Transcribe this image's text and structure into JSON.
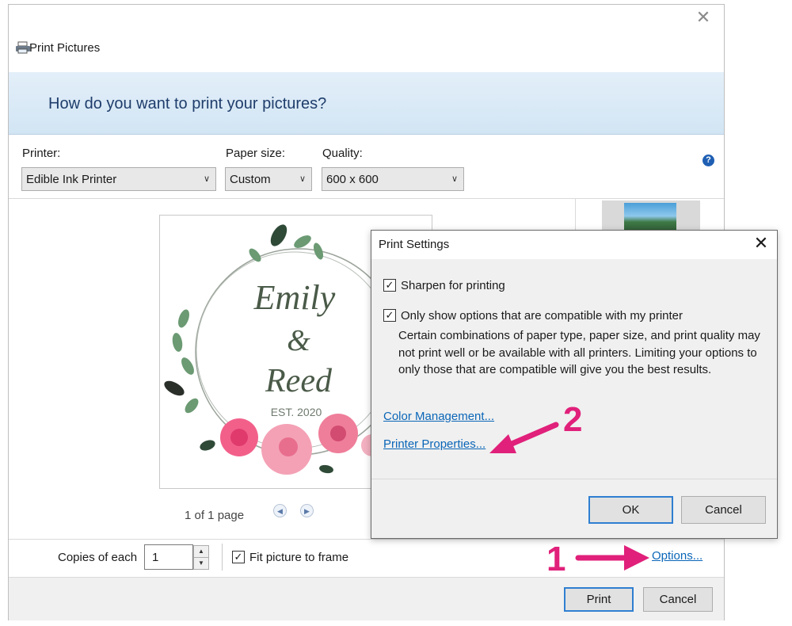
{
  "window": {
    "title": "Print Pictures",
    "close_icon": "close-icon",
    "banner_title": "How do you want to print your pictures?"
  },
  "controls": {
    "printer": {
      "label": "Printer:",
      "value": "Edible Ink Printer"
    },
    "paper_size": {
      "label": "Paper size:",
      "value": "Custom"
    },
    "quality": {
      "label": "Quality:",
      "value": "600 x 600"
    },
    "help_icon": "?"
  },
  "preview": {
    "name_line1": "Emily",
    "name_amp": "&",
    "name_line2": "Reed",
    "est": "EST. 2020",
    "page_count": "1 of 1 page",
    "prev_icon": "◀",
    "next_icon": "▶"
  },
  "bottom": {
    "copies_label": "Copies of each",
    "copies_value": "1",
    "fit_label": "Fit picture to frame",
    "fit_checked": true,
    "options_link": "Options...",
    "print_button": "Print",
    "cancel_button": "Cancel"
  },
  "dialog": {
    "title": "Print Settings",
    "sharpen_label": "Sharpen for printing",
    "sharpen_checked": true,
    "compatible_label": "Only show options that are compatible with my printer",
    "compatible_checked": true,
    "description": "Certain combinations of paper type, paper size, and print quality may not print well or be available with all printers.  Limiting your options to only those that are compatible will give you the best results.",
    "color_management_link": "Color Management...",
    "printer_properties_link": "Printer Properties...",
    "ok_button": "OK",
    "cancel_button": "Cancel"
  },
  "annotations": {
    "step1": "1",
    "step2": "2",
    "color": "#e0207a"
  },
  "colors": {
    "banner_text": "#1e3d6b",
    "link": "#0a66b8",
    "focus_border": "#2f7fd1"
  }
}
